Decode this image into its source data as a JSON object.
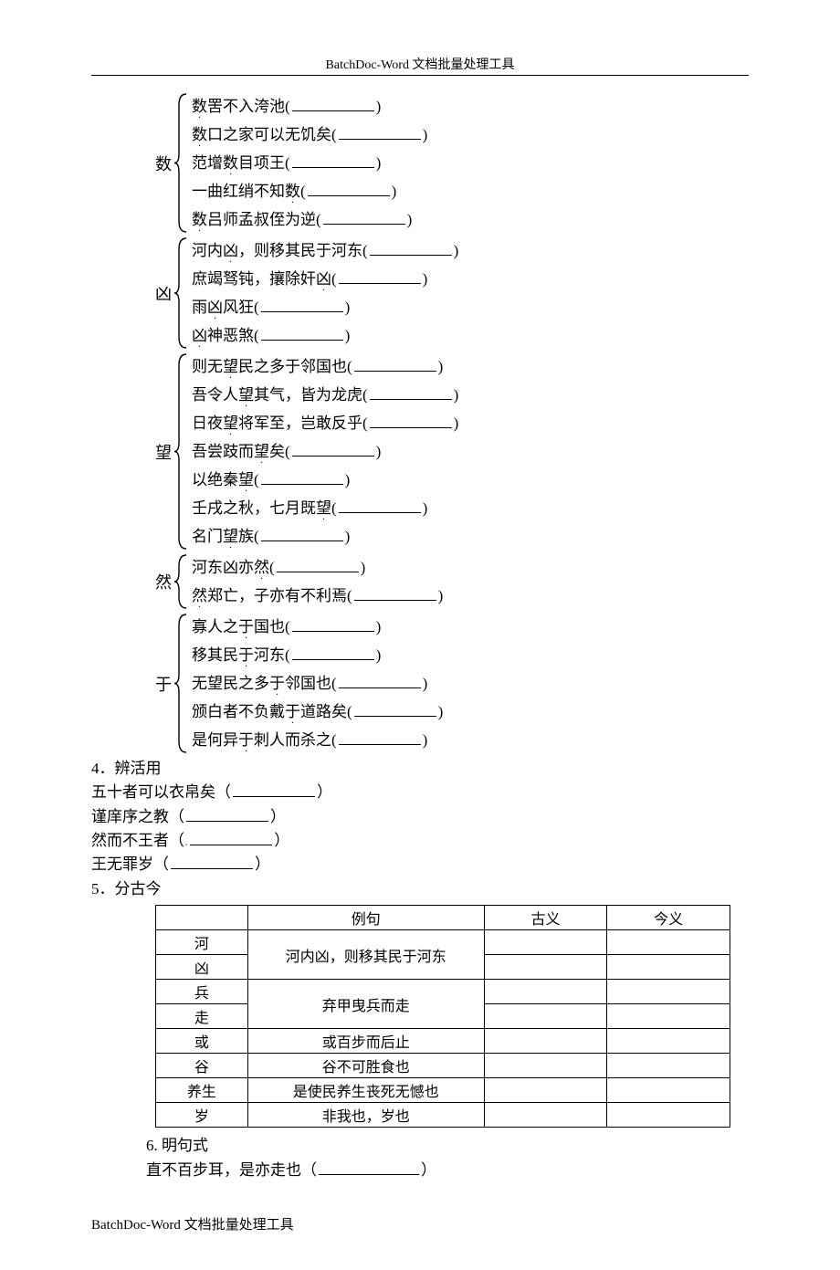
{
  "header": "BatchDoc-Word 文档批量处理工具",
  "footer": "BatchDoc-Word 文档批量处理工具",
  "groups": [
    {
      "label": "数",
      "items": [
        {
          "pre": "",
          "em": "数",
          "post": "罟不入洿池("
        },
        {
          "pre": "",
          "em": "数",
          "post": "口之家可以无饥矣("
        },
        {
          "pre": "范增",
          "em": "数",
          "post": "目项王("
        },
        {
          "pre": "一曲红绡不知",
          "em": "数",
          "post": "("
        },
        {
          "pre": "",
          "em": "数",
          "post": "吕师孟叔侄为逆("
        }
      ]
    },
    {
      "label": "凶",
      "items": [
        {
          "pre": "河内",
          "em": "凶",
          "post": "，则移其民于河东("
        },
        {
          "pre": "庶竭驽钝，攘除奸",
          "em": "凶",
          "post": "("
        },
        {
          "pre": "雨",
          "em": "凶",
          "post": "风狂("
        },
        {
          "pre": "",
          "em": "凶",
          "post": "神恶煞("
        }
      ]
    },
    {
      "label": "望",
      "items": [
        {
          "pre": "则无",
          "em": "望",
          "post": "民之多于邻国也("
        },
        {
          "pre": "吾令人",
          "em": "望",
          "post": "其气，皆为龙虎("
        },
        {
          "pre": "日夜",
          "em": "望",
          "post": "将军至，岂敢反乎("
        },
        {
          "pre": "吾尝跂而",
          "em": "望",
          "post": "矣("
        },
        {
          "pre": "以绝秦",
          "em": "望",
          "post": "("
        },
        {
          "pre": "壬戌之秋，七月既",
          "em": "望",
          "post": "("
        },
        {
          "pre": "名门",
          "em": "望",
          "post": "族("
        }
      ]
    },
    {
      "label": "然",
      "items": [
        {
          "pre": "河东凶亦",
          "em": "然",
          "post": "("
        },
        {
          "pre": "",
          "em": "然",
          "post": "郑亡，子亦有不利焉("
        }
      ]
    },
    {
      "label": "于",
      "items": [
        {
          "pre": "寡人之",
          "em": "于",
          "post": "国也("
        },
        {
          "pre": "移其民",
          "em": "于",
          "post": "河东("
        },
        {
          "pre": "无望民之多",
          "em": "于",
          "post": "邻国也("
        },
        {
          "pre": "颁白者不负戴",
          "em": "于",
          "post": "道路矣("
        },
        {
          "pre": "是何异",
          "em": "于",
          "post": "刺人而杀之("
        }
      ]
    }
  ],
  "sec4": {
    "title": "4．辨活用",
    "lines": [
      "五十者可以衣帛矣（",
      "谨庠序之教（",
      "然而不王者（",
      "王无罪岁（"
    ]
  },
  "sec5_title": "5．分古今",
  "table": {
    "head": [
      "",
      "例句",
      "古义",
      "今义"
    ],
    "rows": [
      {
        "w": "河",
        "s": "河内凶，则移其民于河东",
        "rowspan": 2
      },
      {
        "w": "凶"
      },
      {
        "w": "兵",
        "s": "弃甲曳兵而走",
        "rowspan": 2
      },
      {
        "w": "走"
      },
      {
        "w": "或",
        "s": "或百步而后止"
      },
      {
        "w": "谷",
        "s": "谷不可胜食也"
      },
      {
        "w": "养生",
        "s": "是使民养生丧死无憾也"
      },
      {
        "w": "岁",
        "s": "非我也，岁也"
      }
    ]
  },
  "sec6": {
    "title": "6. 明句式",
    "line": "直不百步耳，是亦走也（"
  }
}
